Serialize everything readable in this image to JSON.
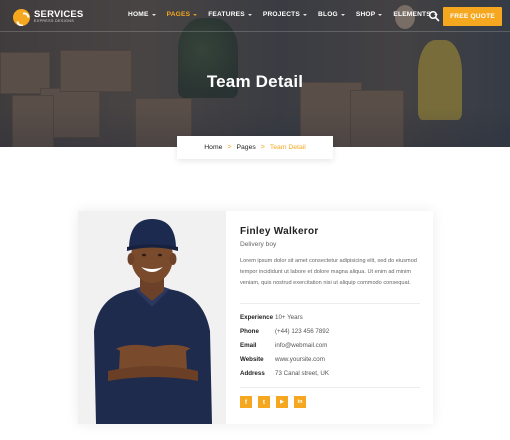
{
  "brand": {
    "name": "SERVICES",
    "tagline": "EXPRESS DESIGNS"
  },
  "nav": [
    {
      "label": "HOME",
      "active": false
    },
    {
      "label": "PAGES",
      "active": true
    },
    {
      "label": "FEATURES",
      "active": false
    },
    {
      "label": "PROJECTS",
      "active": false
    },
    {
      "label": "BLOG",
      "active": false
    },
    {
      "label": "SHOP",
      "active": false
    },
    {
      "label": "ELEMENTS",
      "active": false
    }
  ],
  "header": {
    "quote_button": "FREE QUOTE",
    "search_icon": "search-icon"
  },
  "hero": {
    "title": "Team Detail"
  },
  "breadcrumb": {
    "home": "Home",
    "pages": "Pages",
    "current": "Team Detail",
    "separator": ">"
  },
  "profile": {
    "name": "Finley Walkeror",
    "role": "Delivery boy",
    "bio": "Lorem ipsum dolor sit amet consectetur adipisicing elit, sed do eiusmod tempor incididunt ut labore et dolore magna aliqua. Ut enim ad minim veniam, quis nostrud exercitation nisi ut aliquip commodo consequat.",
    "details": [
      {
        "label": "Experience",
        "value": "10+ Years"
      },
      {
        "label": "Phone",
        "value": "(+44) 123 456 7892"
      },
      {
        "label": "Email",
        "value": "info@webmail.com"
      },
      {
        "label": "Website",
        "value": "www.yoursite.com"
      },
      {
        "label": "Address",
        "value": "73 Canal street, UK"
      }
    ],
    "socials": [
      {
        "icon": "facebook-icon",
        "glyph": "f"
      },
      {
        "icon": "twitter-icon",
        "glyph": "t"
      },
      {
        "icon": "youtube-icon",
        "glyph": "▶"
      },
      {
        "icon": "linkedin-icon",
        "glyph": "in"
      }
    ]
  },
  "colors": {
    "accent": "#f5a71f",
    "text": "#222222",
    "muted": "#666666"
  }
}
